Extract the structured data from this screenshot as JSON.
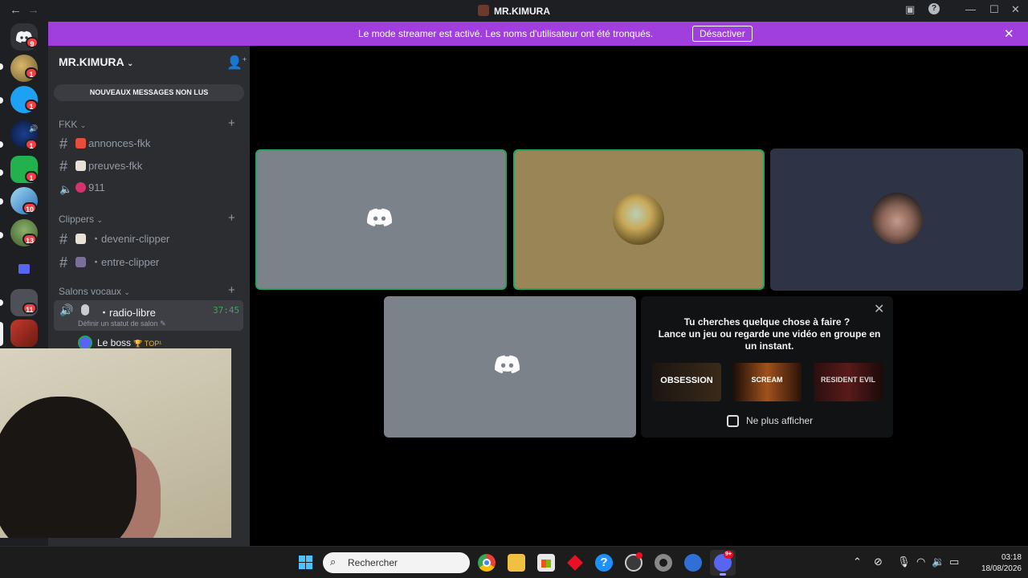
{
  "window": {
    "title": "MR.KIMURA",
    "back": "←",
    "forward": "→"
  },
  "rail": {
    "badges": [
      "9",
      "1",
      "1",
      "1",
      "1",
      "10",
      "13",
      "11"
    ]
  },
  "banner": {
    "text": "Le mode streamer est activé. Les noms d'utilisateur ont été tronqués.",
    "button": "Désactiver",
    "close": "✕"
  },
  "sidebar": {
    "server_name": "MR.KIMURA",
    "new_messages": "NOUVEAUX MESSAGES NON LUS",
    "categories": [
      {
        "name": "FKK",
        "channels": [
          {
            "label": "annonces-fkk"
          },
          {
            "label": "preuves-fkk"
          },
          {
            "label": "911"
          }
        ]
      },
      {
        "name": "Clippers",
        "channels": [
          {
            "label": "・devenir-clipper"
          },
          {
            "label": "・entre-clipper"
          }
        ]
      },
      {
        "name": "Salons vocaux",
        "channels": [
          {
            "label": "・radio-libre",
            "timer": "37:45",
            "status": "Définir un statut de salon"
          }
        ]
      }
    ],
    "member": {
      "name": "Le boss",
      "tag": "🏆 TOP¹"
    }
  },
  "activity": {
    "line1": "Tu cherches quelque chose à faire ?",
    "line2": "Lance un jeu ou regarde une vidéo en groupe en un instant.",
    "thumbs": [
      "OBSESSION",
      "SCREAM",
      "RESIDENT EVIL"
    ],
    "checkbox_label": "Ne plus afficher"
  },
  "taskbar": {
    "search_placeholder": "Rechercher",
    "notif_badge": "9+",
    "time": "03:18",
    "date": "18/08/2026"
  },
  "colors": {
    "banner": "#a03fde",
    "speaking": "#23a55a",
    "tile_gray": "#7c8289",
    "tile_gold": "#9a8556",
    "tile_dark": "#2f3346"
  }
}
